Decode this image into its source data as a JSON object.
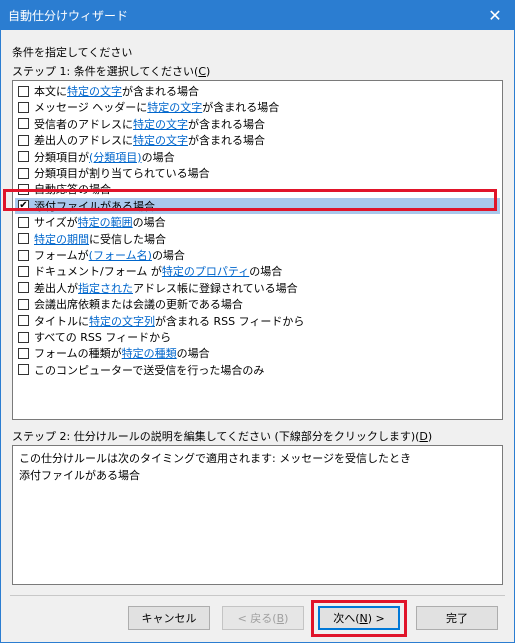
{
  "window": {
    "title": "自動仕分けウィザード",
    "close_glyph": "✕"
  },
  "header": {
    "instruction": "条件を指定してください",
    "step1_prefix": "ステップ 1: 条件を選択してください(",
    "step1_key": "C",
    "step1_suffix": ")"
  },
  "conditions": [
    {
      "checked": false,
      "parts": [
        {
          "t": "本文に "
        },
        {
          "t": "特定の文字",
          "link": true
        },
        {
          "t": " が含まれる場合"
        }
      ]
    },
    {
      "checked": false,
      "parts": [
        {
          "t": "メッセージ ヘッダーに "
        },
        {
          "t": "特定の文字",
          "link": true
        },
        {
          "t": " が含まれる場合"
        }
      ]
    },
    {
      "checked": false,
      "parts": [
        {
          "t": "受信者のアドレスに "
        },
        {
          "t": "特定の文字",
          "link": true
        },
        {
          "t": " が含まれる場合"
        }
      ]
    },
    {
      "checked": false,
      "parts": [
        {
          "t": "差出人のアドレスに "
        },
        {
          "t": "特定の文字",
          "link": true
        },
        {
          "t": " が含まれる場合"
        }
      ]
    },
    {
      "checked": false,
      "parts": [
        {
          "t": "分類項目が "
        },
        {
          "t": "(分類項目)",
          "link": true
        },
        {
          "t": " の場合"
        }
      ]
    },
    {
      "checked": false,
      "parts": [
        {
          "t": "分類項目が割り当てられている場合"
        }
      ]
    },
    {
      "checked": false,
      "parts": [
        {
          "t": "自動応答の場合"
        }
      ]
    },
    {
      "checked": true,
      "selected": true,
      "parts": [
        {
          "t": "添付ファイルがある場合"
        }
      ]
    },
    {
      "checked": false,
      "parts": [
        {
          "t": "サイズが "
        },
        {
          "t": "特定の範囲",
          "link": true
        },
        {
          "t": " の場合"
        }
      ]
    },
    {
      "checked": false,
      "parts": [
        {
          "t": "特定の期間",
          "link": true
        },
        {
          "t": " に受信した場合"
        }
      ]
    },
    {
      "checked": false,
      "parts": [
        {
          "t": "フォームが "
        },
        {
          "t": "(フォーム名)",
          "link": true
        },
        {
          "t": " の場合"
        }
      ]
    },
    {
      "checked": false,
      "parts": [
        {
          "t": "ドキュメント/フォーム が "
        },
        {
          "t": "特定のプロパティ",
          "link": true
        },
        {
          "t": " の場合"
        }
      ]
    },
    {
      "checked": false,
      "parts": [
        {
          "t": "差出人が "
        },
        {
          "t": "指定された",
          "link": true
        },
        {
          "t": " アドレス帳に登録されている場合"
        }
      ]
    },
    {
      "checked": false,
      "parts": [
        {
          "t": "会議出席依頼または会議の更新である場合"
        }
      ]
    },
    {
      "checked": false,
      "parts": [
        {
          "t": "タイトルに "
        },
        {
          "t": "特定の文字列",
          "link": true
        },
        {
          "t": " が含まれる RSS フィードから"
        }
      ]
    },
    {
      "checked": false,
      "parts": [
        {
          "t": "すべての RSS フィードから"
        }
      ]
    },
    {
      "checked": false,
      "parts": [
        {
          "t": "フォームの種類が "
        },
        {
          "t": "特定の種類",
          "link": true
        },
        {
          "t": " の場合"
        }
      ]
    },
    {
      "checked": false,
      "parts": [
        {
          "t": "このコンピューターで送受信を行った場合のみ"
        }
      ]
    }
  ],
  "step2": {
    "prefix": "ステップ 2: 仕分けルールの説明を編集してください (下線部分をクリックします)(",
    "key": "D",
    "suffix": ")",
    "lines": [
      "この仕分けルールは次のタイミングで適用されます: メッセージを受信したとき",
      "添付ファイルがある場合"
    ]
  },
  "buttons": {
    "cancel": "キャンセル",
    "back_prefix": "< 戻る(",
    "back_key": "B",
    "back_suffix": ")",
    "next_prefix": "次へ(",
    "next_key": "N",
    "next_suffix": ") >",
    "finish": "完了"
  },
  "colors": {
    "title_bar": "#2b7dd1",
    "link": "#0066cc",
    "highlight": "#e0142a",
    "selection": "#a9c8ec"
  }
}
